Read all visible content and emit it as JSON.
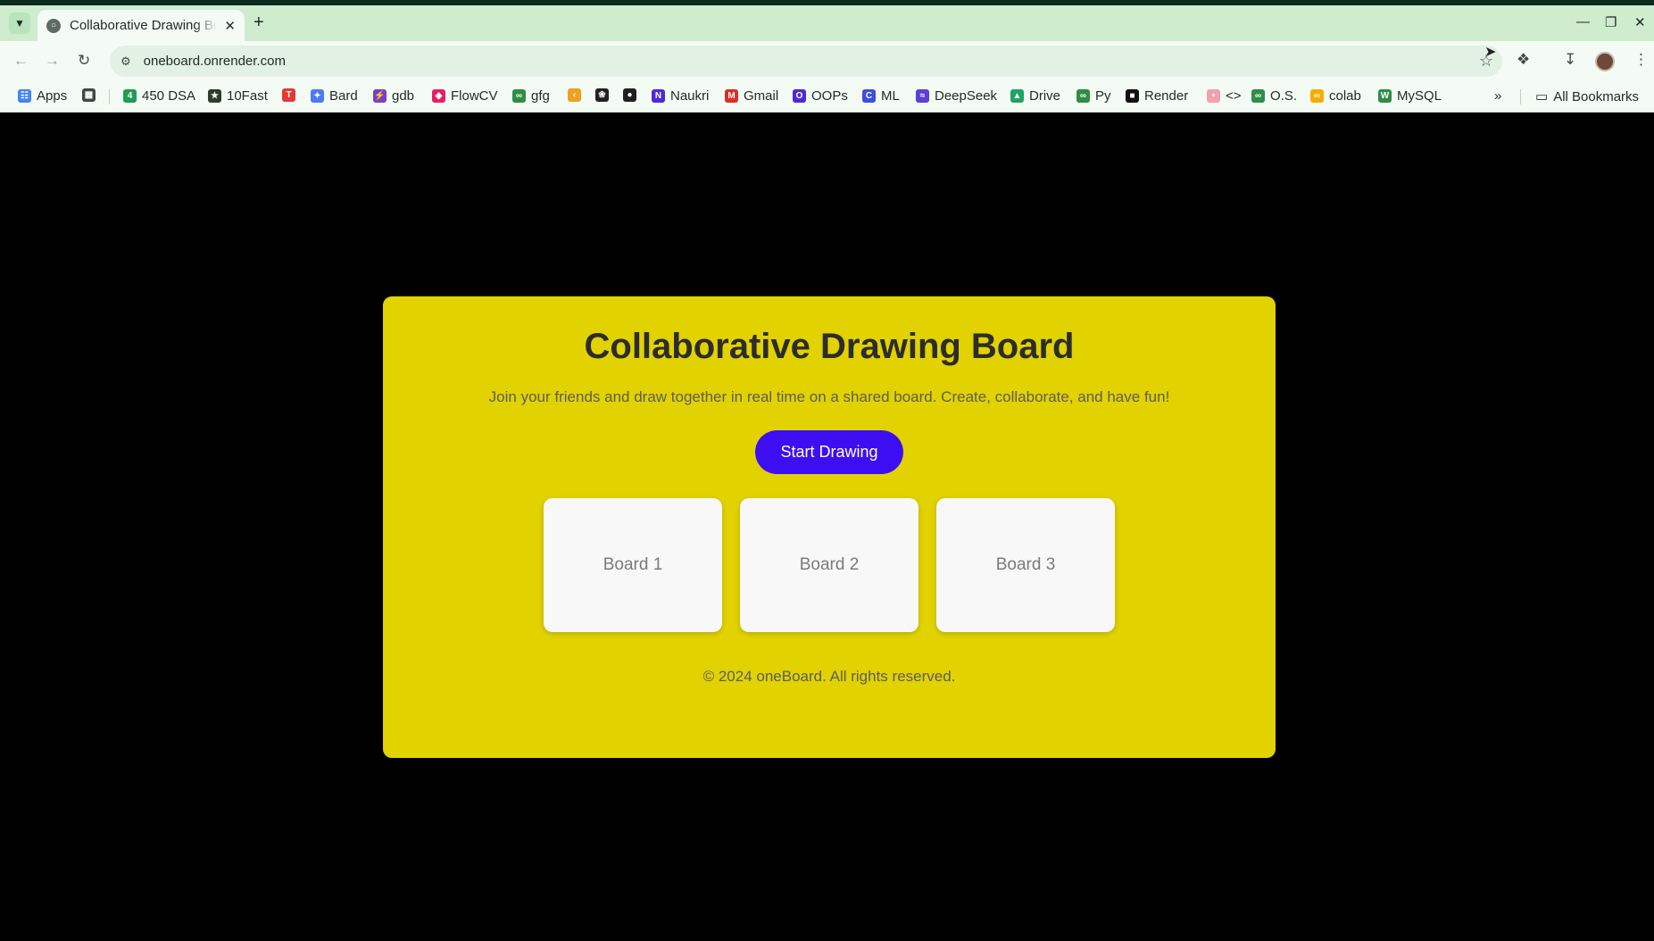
{
  "browser": {
    "tab_title": "Collaborative Drawing Board",
    "new_tab": "+",
    "url": "oneboard.onrender.com",
    "bookmarks": [
      {
        "label": "Apps",
        "icon": "apps-grid-icon",
        "color": "#4285f4"
      },
      {
        "label": "",
        "icon": "tab-groups-icon",
        "color": "#3e4a42"
      },
      {
        "label": "450 DSA",
        "icon": "dsa-icon",
        "color": "#1f9d55"
      },
      {
        "label": "10Fast",
        "icon": "10fast-icon",
        "color": "#2d3b2d"
      },
      {
        "label": "",
        "icon": "tuf-icon",
        "color": "#e53935"
      },
      {
        "label": "Bard",
        "icon": "bard-icon",
        "color": "#4a7bf4"
      },
      {
        "label": "gdb",
        "icon": "gdb-icon",
        "color": "#7b3fc6"
      },
      {
        "label": "FlowCV",
        "icon": "flowcv-icon",
        "color": "#e91e63"
      },
      {
        "label": "gfg",
        "icon": "gfg-icon",
        "color": "#2f8d46"
      },
      {
        "label": "",
        "icon": "leetcode-icon",
        "color": "#f0a020"
      },
      {
        "label": "",
        "icon": "chatgpt-icon",
        "color": "#202020"
      },
      {
        "label": "",
        "icon": "github-icon",
        "color": "#202020"
      },
      {
        "label": "Naukri",
        "icon": "naukri-icon",
        "color": "#4b2bd6"
      },
      {
        "label": "Gmail",
        "icon": "gmail-icon",
        "color": "#d93025"
      },
      {
        "label": "OOPs",
        "icon": "oops-icon",
        "color": "#4b2bd6"
      },
      {
        "label": "ML",
        "icon": "ml-icon",
        "color": "#3d4ee0"
      },
      {
        "label": "DeepSeek",
        "icon": "deepseek-icon",
        "color": "#5b3fd6"
      },
      {
        "label": "Drive",
        "icon": "drive-icon",
        "color": "#1fa463"
      },
      {
        "label": "Py",
        "icon": "py-icon",
        "color": "#2f8d46"
      },
      {
        "label": "Render",
        "icon": "render-icon",
        "color": "#111111"
      },
      {
        "label": "<>",
        "icon": "code-icon",
        "color": "#f0a0b0"
      },
      {
        "label": "O.S.",
        "icon": "os-icon",
        "color": "#2f8d46"
      },
      {
        "label": "colab",
        "icon": "colab-icon",
        "color": "#f9ab00"
      },
      {
        "label": "MySQL",
        "icon": "mysql-icon",
        "color": "#2f8d46"
      }
    ],
    "more_bookmarks": "»",
    "all_bookmarks": "All Bookmarks"
  },
  "page": {
    "title": "Collaborative Drawing Board",
    "subtitle": "Join your friends and draw together in real time on a shared board. Create, collaborate, and have fun!",
    "start_button": "Start Drawing",
    "boards": [
      "Board 1",
      "Board 2",
      "Board 3"
    ],
    "footer": "© 2024 oneBoard. All rights reserved.",
    "colors": {
      "card": "#e1d200",
      "button": "#3d0ef2",
      "background": "#000000"
    }
  }
}
